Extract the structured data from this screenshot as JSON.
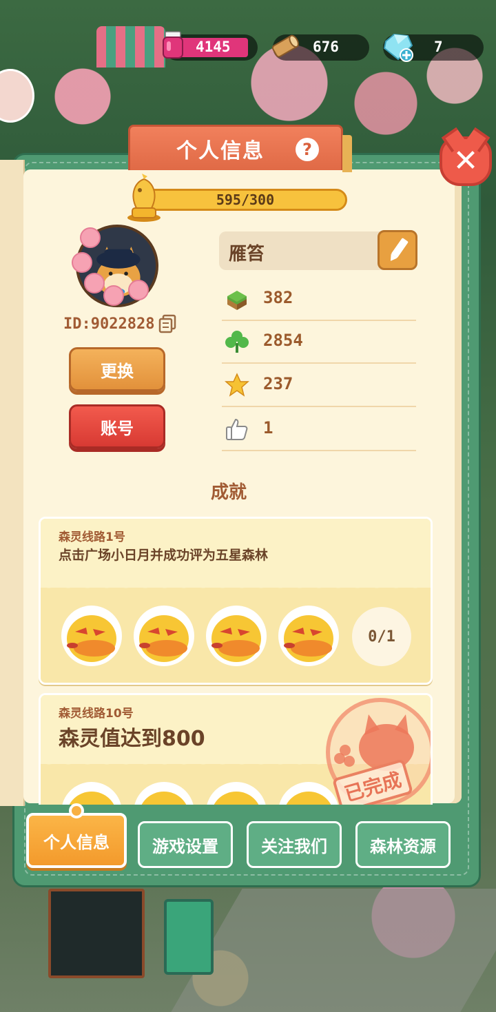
{
  "resources": {
    "ink": "4145",
    "wood": "676",
    "gems": "7"
  },
  "panel": {
    "title": "个人信息",
    "help_glyph": "?",
    "close_glyph": "✕"
  },
  "level": {
    "text": "595/300",
    "fill_fraction": 1.0
  },
  "profile": {
    "id_text": "ID:9022828",
    "name": "雁笞",
    "change_label": "更换",
    "account_label": "账号"
  },
  "stats": [
    {
      "icon": "grass-block-icon",
      "value": "382"
    },
    {
      "icon": "clover-icon",
      "value": "2854"
    },
    {
      "icon": "star-icon",
      "value": "237"
    },
    {
      "icon": "thumbs-up-icon",
      "value": "1"
    }
  ],
  "achievements": {
    "title": "成就",
    "cards": [
      {
        "subtitle": "森灵线路1号",
        "description": "点击广场小日月并成功评为五星森林",
        "progress": "0/1",
        "completed": false
      },
      {
        "subtitle": "森灵线路10号",
        "description": "森灵值达到800",
        "stamp": "已完成",
        "completed": true
      }
    ]
  },
  "tabs": [
    {
      "label": "个人信息",
      "active": true
    },
    {
      "label": "游戏设置",
      "active": false
    },
    {
      "label": "关注我们",
      "active": false
    },
    {
      "label": "森林资源",
      "active": false
    }
  ],
  "colors": {
    "panel_green": "#4f9a72",
    "paper": "#fdf5dc",
    "title_orange": "#e06a46",
    "accent_brown": "#a15b34"
  }
}
